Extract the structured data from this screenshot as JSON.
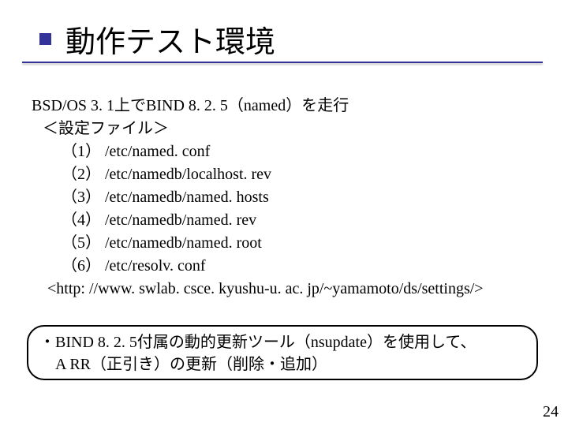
{
  "title": "動作テスト環境",
  "body": {
    "line0": "BSD/OS 3. 1上でBIND 8. 2. 5（named）を走行",
    "heading": "＜設定ファイル＞",
    "items": {
      "i1": "（1） /etc/named. conf",
      "i2": "（2） /etc/namedb/localhost. rev",
      "i3": "（3） /etc/namedb/named. hosts",
      "i4": "（4） /etc/namedb/named. rev",
      "i5": "（5） /etc/namedb/named. root",
      "i6": "（6） /etc/resolv. conf"
    },
    "url": "<http: //www. swlab. csce. kyushu-u. ac. jp/~yamamoto/ds/settings/>"
  },
  "box": {
    "l1": "・BIND 8. 2. 5付属の動的更新ツール（nsupdate）を使用して、",
    "l2": "　A RR（正引き）の更新（削除・追加）"
  },
  "page": "24"
}
